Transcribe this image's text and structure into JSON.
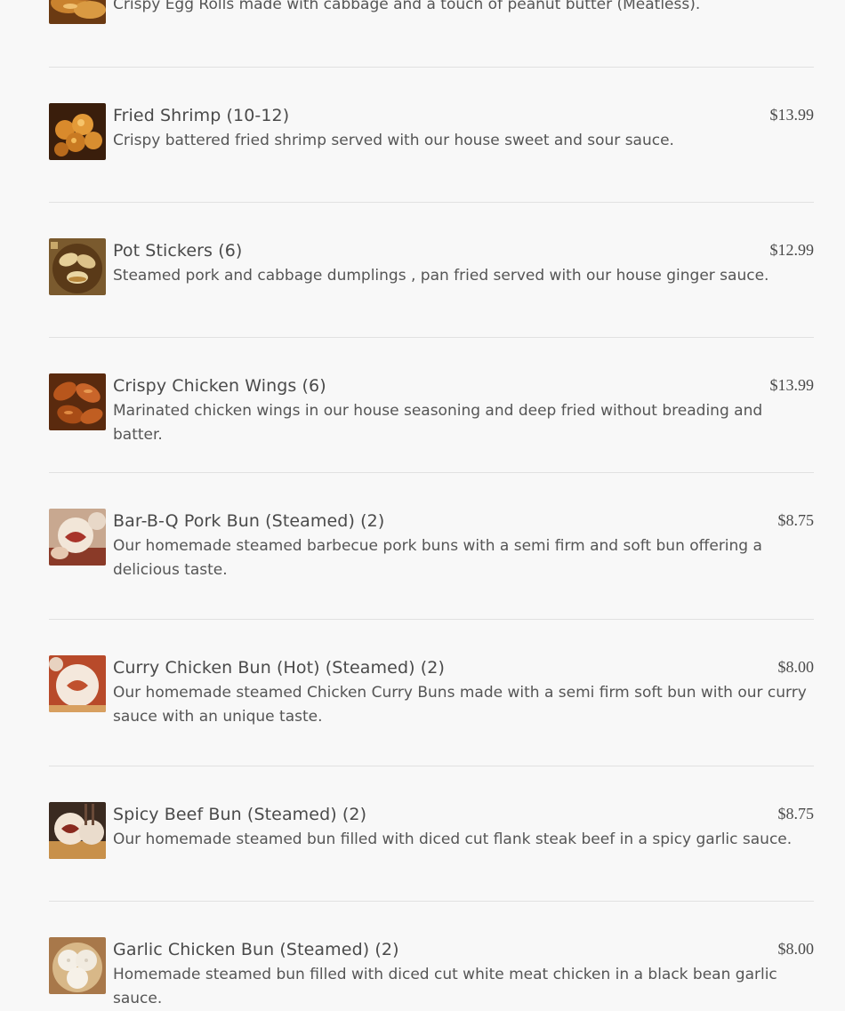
{
  "menu": {
    "items": [
      {
        "name": "",
        "price": "",
        "description": "Crispy Egg Rolls made with cabbage and a touch of peanut butter (Meatless).",
        "image_icon": "egg-rolls-photo"
      },
      {
        "name": "Fried Shrimp (10-12)",
        "price": "$13.99",
        "description": "Crispy battered fried shrimp served with our house sweet and sour sauce.",
        "image_icon": "fried-shrimp-photo"
      },
      {
        "name": "Pot Stickers (6)",
        "price": "$12.99",
        "description": "Steamed pork and cabbage dumplings , pan fried served with our house ginger sauce.",
        "image_icon": "pot-stickers-photo"
      },
      {
        "name": "Crispy Chicken Wings (6)",
        "price": "$13.99",
        "description": "Marinated chicken wings in our house seasoning and deep fried without breading and batter.",
        "image_icon": "chicken-wings-photo"
      },
      {
        "name": "Bar-B-Q Pork Bun (Steamed) (2)",
        "price": "$8.75",
        "description": "Our homemade steamed barbecue pork buns with a semi firm and soft bun offering a delicious taste.",
        "image_icon": "bbq-pork-bun-photo"
      },
      {
        "name": "Curry Chicken Bun (Hot) (Steamed) (2)",
        "price": "$8.00",
        "description": "Our homemade steamed Chicken Curry Buns made with a semi firm soft bun with our curry sauce with an unique taste.",
        "image_icon": "curry-chicken-bun-photo"
      },
      {
        "name": "Spicy Beef Bun (Steamed) (2)",
        "price": "$8.75",
        "description": "Our homemade steamed bun filled with diced cut flank steak beef in a spicy garlic sauce.",
        "image_icon": "spicy-beef-bun-photo"
      },
      {
        "name": "Garlic Chicken Bun (Steamed) (2)",
        "price": "$8.00",
        "description": "Homemade steamed bun filled with diced cut white meat chicken in a black bean garlic sauce.",
        "image_icon": "garlic-chicken-bun-photo"
      }
    ]
  },
  "colors": {
    "background": "#f8f8f8",
    "text": "#4a4a4a",
    "divider": "#e1e1e1"
  }
}
